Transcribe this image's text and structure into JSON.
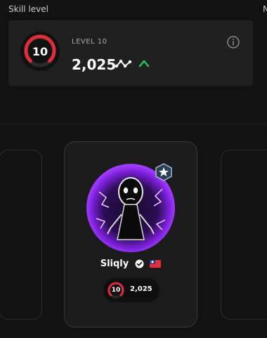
{
  "header": {
    "skill_level_label": "Skill level",
    "second_section_label": "N"
  },
  "skill_card": {
    "level_number": "10",
    "level_label": "LEVEL 10",
    "elo_value": "2,025",
    "trend": "up",
    "icons": [
      "elo-graph-icon",
      "trend-up-icon",
      "info-icon"
    ],
    "colors": {
      "level_ring": "#e02d3c",
      "trend_up": "#2bbd5c"
    }
  },
  "player": {
    "name": "Sliqly",
    "verified": true,
    "country_flag": "flag-icon",
    "level_number": "10",
    "elo_value": "2,025",
    "badge": "shield-star-icon",
    "avatar_colors": {
      "glow": "#a23dff",
      "dark": "#1b0a2d"
    }
  }
}
